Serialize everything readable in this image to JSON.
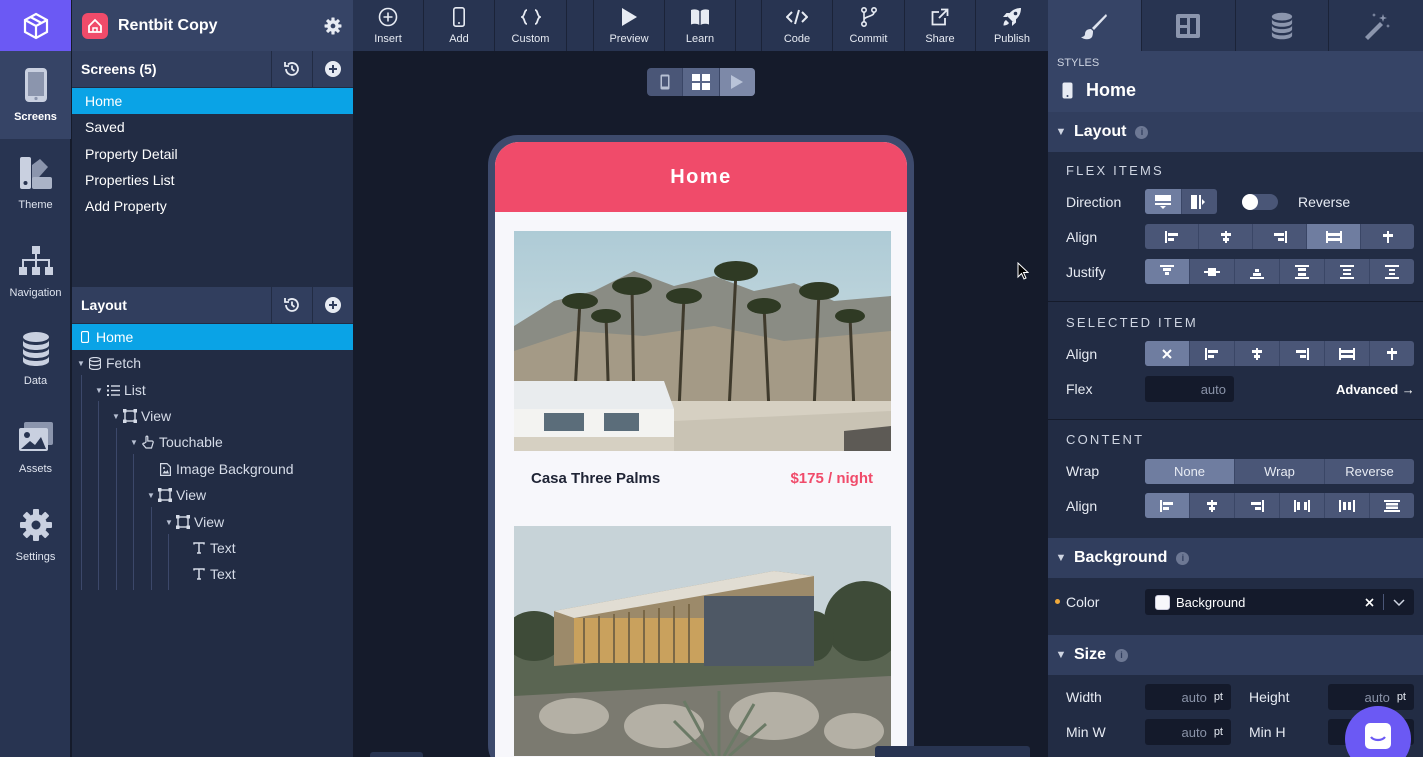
{
  "app": {
    "name": "Rentbit Copy"
  },
  "rail": {
    "items": [
      {
        "label": "Screens",
        "icon": "phone-icon"
      },
      {
        "label": "Theme",
        "icon": "palette-icon"
      },
      {
        "label": "Navigation",
        "icon": "sitemap-icon"
      },
      {
        "label": "Data",
        "icon": "database-icon"
      },
      {
        "label": "Assets",
        "icon": "image-icon"
      },
      {
        "label": "Settings",
        "icon": "gear-icon"
      }
    ]
  },
  "screens": {
    "title": "Screens (5)",
    "items": [
      "Home",
      "Saved",
      "Property Detail",
      "Properties List",
      "Add Property"
    ],
    "selected": "Home"
  },
  "layout": {
    "title": "Layout",
    "tree": [
      {
        "label": "Home",
        "icon": "phone-icon"
      },
      {
        "label": "Fetch",
        "icon": "database-icon"
      },
      {
        "label": "List",
        "icon": "list-icon"
      },
      {
        "label": "View",
        "icon": "view-icon"
      },
      {
        "label": "Touchable",
        "icon": "hand-icon"
      },
      {
        "label": "Image Background",
        "icon": "file-image-icon"
      },
      {
        "label": "View",
        "icon": "view-icon"
      },
      {
        "label": "View",
        "icon": "view-icon"
      },
      {
        "label": "Text",
        "icon": "text-icon"
      },
      {
        "label": "Text",
        "icon": "text-icon"
      }
    ]
  },
  "toolbar": {
    "insert": "Insert",
    "add": "Add",
    "custom": "Custom",
    "preview": "Preview",
    "learn": "Learn",
    "code": "Code",
    "commit": "Commit",
    "share": "Share",
    "publish": "Publish"
  },
  "phone": {
    "header": "Home",
    "cards": [
      {
        "name": "Casa Three Palms",
        "price": "$175 / night"
      }
    ]
  },
  "styles": {
    "label": "STYLES",
    "screen": "Home",
    "layout": {
      "title": "Layout",
      "flex_items": "FLEX ITEMS",
      "direction": "Direction",
      "reverse": "Reverse",
      "align": "Align",
      "justify": "Justify",
      "selected_item": "SELECTED ITEM",
      "flex": "Flex",
      "flex_placeholder": "auto",
      "advanced": "Advanced →",
      "content": "CONTENT",
      "wrap": "Wrap",
      "wrap_options": [
        "None",
        "Wrap",
        "Reverse"
      ],
      "content_align": "Align"
    },
    "background": {
      "title": "Background",
      "color_label": "Color",
      "color_value": "Background"
    },
    "size": {
      "title": "Size",
      "width": "Width",
      "height": "Height",
      "min_w": "Min W",
      "min_h": "Min H",
      "auto": "auto",
      "unit": "pt"
    }
  },
  "colors": {
    "accent": "#f04b6a",
    "brand": "#6b59f4",
    "selection": "#0aa3e6"
  }
}
